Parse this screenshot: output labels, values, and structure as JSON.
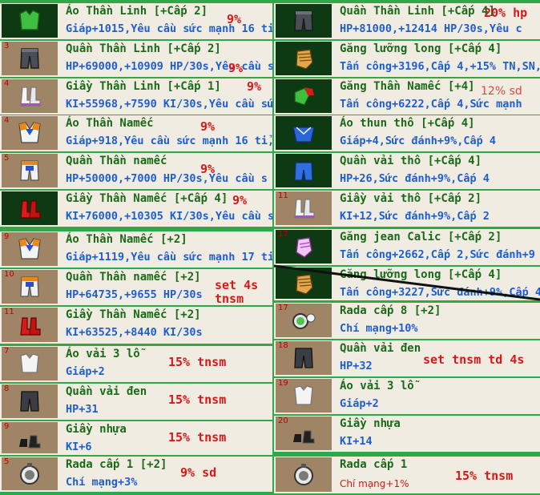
{
  "left": [
    {
      "num": "",
      "name": "Áo Thần Linh [+Cấp 2]",
      "stats": "Giáp+1015,Yêu cầu sức mạnh 16 tỉ,",
      "note": "9%",
      "icon": "green-armor-icon"
    },
    {
      "num": "3",
      "name": "Quần Thần Linh [+Cấp 2]",
      "stats": "HP+69000,+10909 HP/30s,Yêu cầu s",
      "note": "9%",
      "icon": "gray-pants-icon"
    },
    {
      "num": "4",
      "name": "Giầy Thần Linh [+Cấp 1]",
      "stats": "KI+55968,+7590 KI/30s,Yêu cầu sức",
      "note": "9%",
      "icon": "white-boots-icon"
    },
    {
      "num": "4",
      "name": "Áo Thần Namếc",
      "stats": "Giáp+918,Yêu cầu sức mạnh 16 tỉ,",
      "note": "9%",
      "icon": "namek-armor-icon"
    },
    {
      "num": "5",
      "name": "Quần Thần namếc",
      "stats": "HP+50000,+7000 HP/30s,Yêu cầu s",
      "note": "9%",
      "icon": "namek-pants-icon"
    },
    {
      "num": "",
      "name": "Giầy Thần Namếc [+Cấp 4]",
      "stats": "KI+76000,+10305 KI/30s,Yêu cầu s",
      "note": "9%",
      "icon": "red-boots-icon"
    },
    {
      "num": "9",
      "name": "Áo Thần Namếc [+2]",
      "stats": "Giáp+1119,Yêu cầu sức mạnh 17 tỉ",
      "note": "",
      "icon": "namek-armor-icon"
    },
    {
      "num": "10",
      "name": "Quần Thần namếc [+2]",
      "stats": "HP+64735,+9655 HP/30s",
      "note": "set 4s\ntnsm",
      "icon": "namek-pants-icon"
    },
    {
      "num": "11",
      "name": "Giầy Thần Namếc [+2]",
      "stats": "KI+63525,+8440 KI/30s",
      "note": "",
      "icon": "red-boots-icon"
    },
    {
      "num": "7",
      "name": "Áo vải 3 lỗ",
      "stats": "Giáp+2",
      "note": "15% tnsm",
      "icon": "white-shirt-icon"
    },
    {
      "num": "8",
      "name": "Quần vải đen",
      "stats": "HP+31",
      "note": "15% tnsm",
      "icon": "black-pants-icon"
    },
    {
      "num": "9",
      "name": "Giầy nhựa",
      "stats": "KI+6",
      "note": "15% tnsm",
      "icon": "black-shoes-icon"
    },
    {
      "num": "5",
      "name": "Rada cấp 1 [+2]",
      "stats": "Chí mạng+3%",
      "note": "9% sd",
      "icon": "radar-icon"
    }
  ],
  "right": [
    {
      "num": "",
      "name": "Quần Thần Linh [+Cấp 4]",
      "stats": "HP+81000,+12414 HP/30s,Yêu c",
      "note": "20% hp",
      "icon": "gray-pants-icon"
    },
    {
      "num": "",
      "name": "Găng lưỡng long [+Cấp 4]",
      "stats": "Tấn công+3196,Cấp 4,+15% TN,SN,",
      "note": "",
      "icon": "dragon-glove-icon"
    },
    {
      "num": "",
      "name": "Găng Thần Namếc [+4]",
      "stats": "Tấn công+6222,Cấp 4,Sức mạnh",
      "note": "12% sd",
      "icon": "green-glove-icon"
    },
    {
      "num": "",
      "name": "Áo thun thô [+Cấp 4]",
      "stats": "Giáp+4,Sức đánh+9%,Cấp 4",
      "note": "",
      "icon": "blue-shirt-icon"
    },
    {
      "num": "",
      "name": "Quần vải thô [+Cấp 4]",
      "stats": "HP+26,Sức đánh+9%,Cấp 4",
      "note": "",
      "icon": "blue-pants-icon"
    },
    {
      "num": "11",
      "name": "Giầy vải thô [+Cấp 2]",
      "stats": "KI+12,Sức đánh+9%,Cấp 2",
      "note": "",
      "icon": "white-boots-icon"
    },
    {
      "num": "17",
      "name": "Găng jean Calic [+Cấp 2]",
      "stats": "Tấn công+2662,Cấp 2,Sức đánh+9",
      "note": "",
      "icon": "pink-glove-icon"
    },
    {
      "num": "",
      "name": "Găng lưỡng long [+Cấp 4]",
      "stats": "Tấn công+3227,Sức đánh+9%,Cấp 4",
      "note": "",
      "icon": "dragon-glove-icon"
    },
    {
      "num": "17",
      "name": "Rada cấp 8 [+2]",
      "stats": "Chí mạng+10%",
      "note": "",
      "icon": "radar-green-icon"
    },
    {
      "num": "18",
      "name": "Quần vải đen",
      "stats": "HP+32",
      "note": "set tnsm td 4s",
      "icon": "black-pants-icon"
    },
    {
      "num": "19",
      "name": "Áo vải 3 lỗ",
      "stats": "Giáp+2",
      "note": "",
      "icon": "white-shirt-icon"
    },
    {
      "num": "20",
      "name": "Giầy nhựa",
      "stats": "KI+14",
      "note": "",
      "icon": "black-shoes-icon"
    },
    {
      "num": "",
      "name": "Rada cấp 1",
      "stats": "Chí mạng+1%",
      "note": "15% tnsm",
      "icon": "radar-icon"
    }
  ]
}
